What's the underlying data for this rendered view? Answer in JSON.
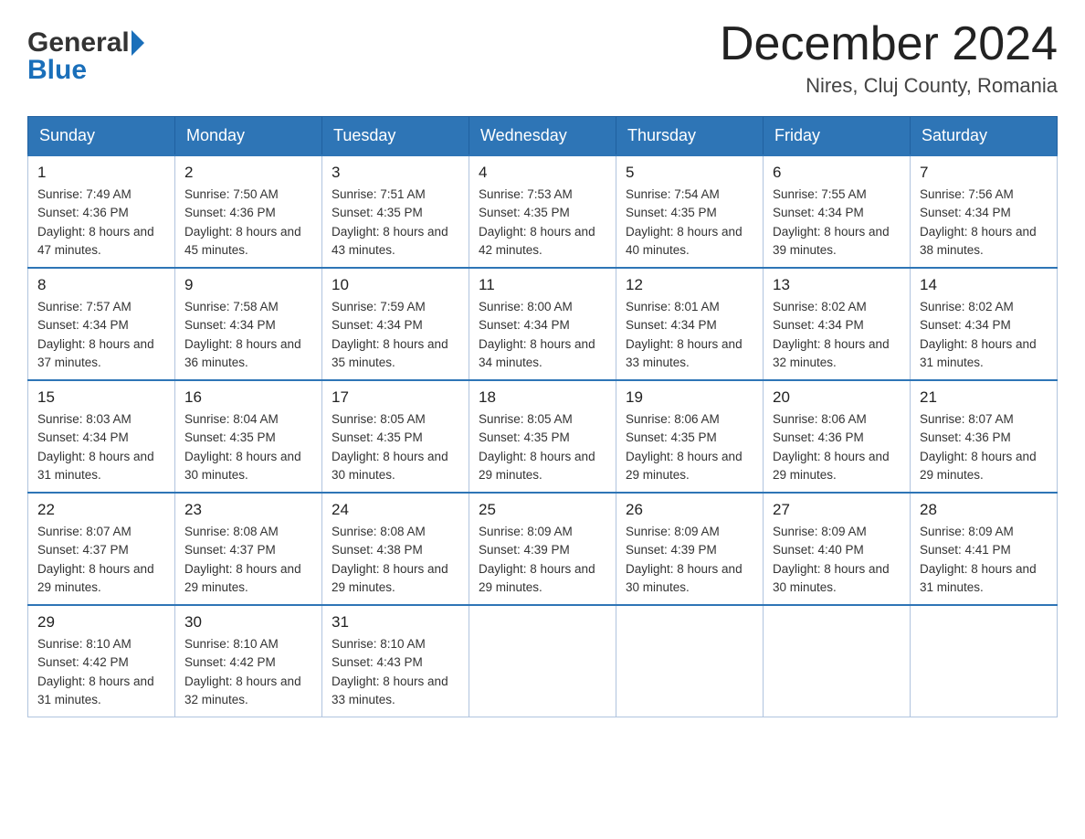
{
  "header": {
    "logo_line1": "General",
    "logo_line2": "Blue",
    "month_title": "December 2024",
    "location": "Nires, Cluj County, Romania"
  },
  "weekdays": [
    "Sunday",
    "Monday",
    "Tuesday",
    "Wednesday",
    "Thursday",
    "Friday",
    "Saturday"
  ],
  "weeks": [
    [
      {
        "day": "1",
        "sunrise": "7:49 AM",
        "sunset": "4:36 PM",
        "daylight": "8 hours and 47 minutes."
      },
      {
        "day": "2",
        "sunrise": "7:50 AM",
        "sunset": "4:36 PM",
        "daylight": "8 hours and 45 minutes."
      },
      {
        "day": "3",
        "sunrise": "7:51 AM",
        "sunset": "4:35 PM",
        "daylight": "8 hours and 43 minutes."
      },
      {
        "day": "4",
        "sunrise": "7:53 AM",
        "sunset": "4:35 PM",
        "daylight": "8 hours and 42 minutes."
      },
      {
        "day": "5",
        "sunrise": "7:54 AM",
        "sunset": "4:35 PM",
        "daylight": "8 hours and 40 minutes."
      },
      {
        "day": "6",
        "sunrise": "7:55 AM",
        "sunset": "4:34 PM",
        "daylight": "8 hours and 39 minutes."
      },
      {
        "day": "7",
        "sunrise": "7:56 AM",
        "sunset": "4:34 PM",
        "daylight": "8 hours and 38 minutes."
      }
    ],
    [
      {
        "day": "8",
        "sunrise": "7:57 AM",
        "sunset": "4:34 PM",
        "daylight": "8 hours and 37 minutes."
      },
      {
        "day": "9",
        "sunrise": "7:58 AM",
        "sunset": "4:34 PM",
        "daylight": "8 hours and 36 minutes."
      },
      {
        "day": "10",
        "sunrise": "7:59 AM",
        "sunset": "4:34 PM",
        "daylight": "8 hours and 35 minutes."
      },
      {
        "day": "11",
        "sunrise": "8:00 AM",
        "sunset": "4:34 PM",
        "daylight": "8 hours and 34 minutes."
      },
      {
        "day": "12",
        "sunrise": "8:01 AM",
        "sunset": "4:34 PM",
        "daylight": "8 hours and 33 minutes."
      },
      {
        "day": "13",
        "sunrise": "8:02 AM",
        "sunset": "4:34 PM",
        "daylight": "8 hours and 32 minutes."
      },
      {
        "day": "14",
        "sunrise": "8:02 AM",
        "sunset": "4:34 PM",
        "daylight": "8 hours and 31 minutes."
      }
    ],
    [
      {
        "day": "15",
        "sunrise": "8:03 AM",
        "sunset": "4:34 PM",
        "daylight": "8 hours and 31 minutes."
      },
      {
        "day": "16",
        "sunrise": "8:04 AM",
        "sunset": "4:35 PM",
        "daylight": "8 hours and 30 minutes."
      },
      {
        "day": "17",
        "sunrise": "8:05 AM",
        "sunset": "4:35 PM",
        "daylight": "8 hours and 30 minutes."
      },
      {
        "day": "18",
        "sunrise": "8:05 AM",
        "sunset": "4:35 PM",
        "daylight": "8 hours and 29 minutes."
      },
      {
        "day": "19",
        "sunrise": "8:06 AM",
        "sunset": "4:35 PM",
        "daylight": "8 hours and 29 minutes."
      },
      {
        "day": "20",
        "sunrise": "8:06 AM",
        "sunset": "4:36 PM",
        "daylight": "8 hours and 29 minutes."
      },
      {
        "day": "21",
        "sunrise": "8:07 AM",
        "sunset": "4:36 PM",
        "daylight": "8 hours and 29 minutes."
      }
    ],
    [
      {
        "day": "22",
        "sunrise": "8:07 AM",
        "sunset": "4:37 PM",
        "daylight": "8 hours and 29 minutes."
      },
      {
        "day": "23",
        "sunrise": "8:08 AM",
        "sunset": "4:37 PM",
        "daylight": "8 hours and 29 minutes."
      },
      {
        "day": "24",
        "sunrise": "8:08 AM",
        "sunset": "4:38 PM",
        "daylight": "8 hours and 29 minutes."
      },
      {
        "day": "25",
        "sunrise": "8:09 AM",
        "sunset": "4:39 PM",
        "daylight": "8 hours and 29 minutes."
      },
      {
        "day": "26",
        "sunrise": "8:09 AM",
        "sunset": "4:39 PM",
        "daylight": "8 hours and 30 minutes."
      },
      {
        "day": "27",
        "sunrise": "8:09 AM",
        "sunset": "4:40 PM",
        "daylight": "8 hours and 30 minutes."
      },
      {
        "day": "28",
        "sunrise": "8:09 AM",
        "sunset": "4:41 PM",
        "daylight": "8 hours and 31 minutes."
      }
    ],
    [
      {
        "day": "29",
        "sunrise": "8:10 AM",
        "sunset": "4:42 PM",
        "daylight": "8 hours and 31 minutes."
      },
      {
        "day": "30",
        "sunrise": "8:10 AM",
        "sunset": "4:42 PM",
        "daylight": "8 hours and 32 minutes."
      },
      {
        "day": "31",
        "sunrise": "8:10 AM",
        "sunset": "4:43 PM",
        "daylight": "8 hours and 33 minutes."
      },
      null,
      null,
      null,
      null
    ]
  ]
}
